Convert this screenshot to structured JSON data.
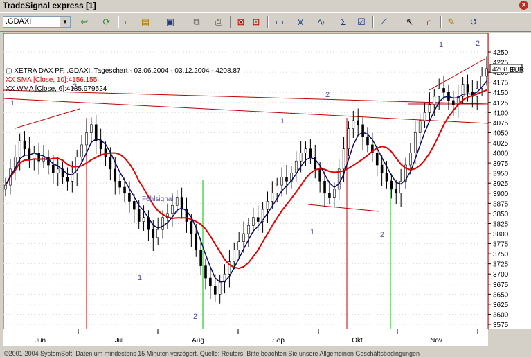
{
  "window": {
    "title": "TradeSignal express [1]"
  },
  "toolbar": {
    "symbol": ".GDAXI"
  },
  "legend": {
    "line1": "XETRA DAX PF, .GDAXI, Tageschart - 03.06.2004 - 03.12.2004 - 4208.87",
    "line2": "XX SMA [Close, 10]:4156.155",
    "line3": "XX WMA [Close, 6]:4185.979524"
  },
  "axis": {
    "currency": "EUR",
    "last_price": "4208.87"
  },
  "annotation": {
    "fehlsignal": "Fehlsignal"
  },
  "footer": {
    "text": "©2001-2004 SystemSoft. Daten um mindestens 15 Minuten verzögert. Quelle: Reuters. Bitte beachten Sie unsere Allgemeinen Geschäftsbedingungen"
  },
  "chart_data": {
    "type": "candlestick",
    "y_ticks": [
      4250,
      4225,
      4200,
      4175,
      4150,
      4125,
      4100,
      4075,
      4050,
      4025,
      4000,
      3975,
      3950,
      3925,
      3900,
      3875,
      3850,
      3825,
      3800,
      3775,
      3750,
      3725,
      3700,
      3675,
      3650,
      3625,
      3600,
      3575
    ],
    "ylim": [
      3565,
      4265
    ],
    "x_ticks": [
      "Jun",
      "Jul",
      "Aug",
      "Sep",
      "Okt",
      "Nov"
    ],
    "close": [
      3920,
      3960,
      3990,
      4030,
      4010,
      3985,
      4000,
      3980,
      3990,
      3970,
      3950,
      3960,
      3940,
      3930,
      3950,
      3990,
      4020,
      4050,
      4070,
      4030,
      4010,
      3990,
      3960,
      3930,
      3915,
      3900,
      3880,
      3860,
      3830,
      3840,
      3810,
      3790,
      3810,
      3840,
      3850,
      3870,
      3890,
      3860,
      3830,
      3800,
      3760,
      3720,
      3690,
      3670,
      3650,
      3680,
      3700,
      3730,
      3760,
      3780,
      3800,
      3820,
      3840,
      3830,
      3860,
      3880,
      3900,
      3920,
      3940,
      3930,
      3950,
      3980,
      4000,
      4010,
      3990,
      3960,
      3930,
      3900,
      3890,
      3910,
      3960,
      4010,
      4060,
      4080,
      4070,
      4040,
      4020,
      4000,
      3970,
      3950,
      3930,
      3910,
      3900,
      3930,
      3970,
      4000,
      4050,
      4080,
      4100,
      4120,
      4140,
      4160,
      4150,
      4130,
      4120,
      4140,
      4170,
      4150,
      4140,
      4160,
      4190,
      4209
    ],
    "series": [
      {
        "name": "XX SMA [Close, 10]",
        "color": "#e00000",
        "last": 4156.155
      },
      {
        "name": "XX WMA [Close, 6]",
        "color": "#0a0a60",
        "last": 4185.979524
      }
    ],
    "wave_labels": [
      "1",
      "2",
      "1",
      "2",
      "1",
      "2",
      "1",
      "2",
      "1",
      "2"
    ]
  },
  "colors": {
    "up": "#000000",
    "sma": "#e00000",
    "wma": "#0a0a60",
    "trend": "#c00000",
    "vline_red": "#c00000",
    "vline_green": "#00c000",
    "wave": "#5050a0"
  }
}
